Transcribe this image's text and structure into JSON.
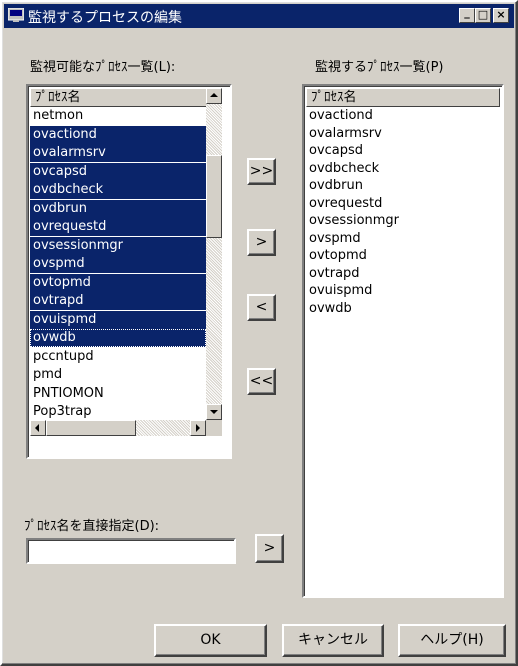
{
  "window": {
    "title": "監視するプロセスの編集",
    "minimize_glyph": "_",
    "maximize_glyph": "□",
    "close_glyph": "×"
  },
  "available": {
    "label": "監視可能なﾌﾟﾛｾｽ一覧(L):",
    "column_header": "ﾌﾟﾛｾｽ名",
    "items": [
      "netmon",
      "ovactiond",
      "ovalarmsrv",
      "ovcapsd",
      "ovdbcheck",
      "ovdbrun",
      "ovrequestd",
      "ovsessionmgr",
      "ovspmd",
      "ovtopmd",
      "ovtrapd",
      "ovuispmd",
      "ovwdb",
      "pccntupd",
      "pmd",
      "PNTIOMON",
      "Pop3trap"
    ],
    "selected_indices": [
      1,
      2,
      3,
      4,
      5,
      6,
      7,
      8,
      9,
      10,
      11,
      12
    ],
    "focused_index": 12
  },
  "monitored": {
    "label": "監視するﾌﾟﾛｾｽ一覧(P)",
    "column_header": "ﾌﾟﾛｾｽ名",
    "items": [
      "ovactiond",
      "ovalarmsrv",
      "ovcapsd",
      "ovdbcheck",
      "ovdbrun",
      "ovrequestd",
      "ovsessionmgr",
      "ovspmd",
      "ovtopmd",
      "ovtrapd",
      "ovuispmd",
      "ovwdb"
    ]
  },
  "transfer_buttons": {
    "add_all": ">>",
    "add": ">",
    "remove": "<",
    "remove_all": "<<"
  },
  "direct": {
    "label": "ﾌﾟﾛｾｽ名を直接指定(D):",
    "value": "",
    "add_button": ">"
  },
  "footer": {
    "ok": "OK",
    "cancel": "キャンセル",
    "help": "ヘルプ(H)"
  }
}
